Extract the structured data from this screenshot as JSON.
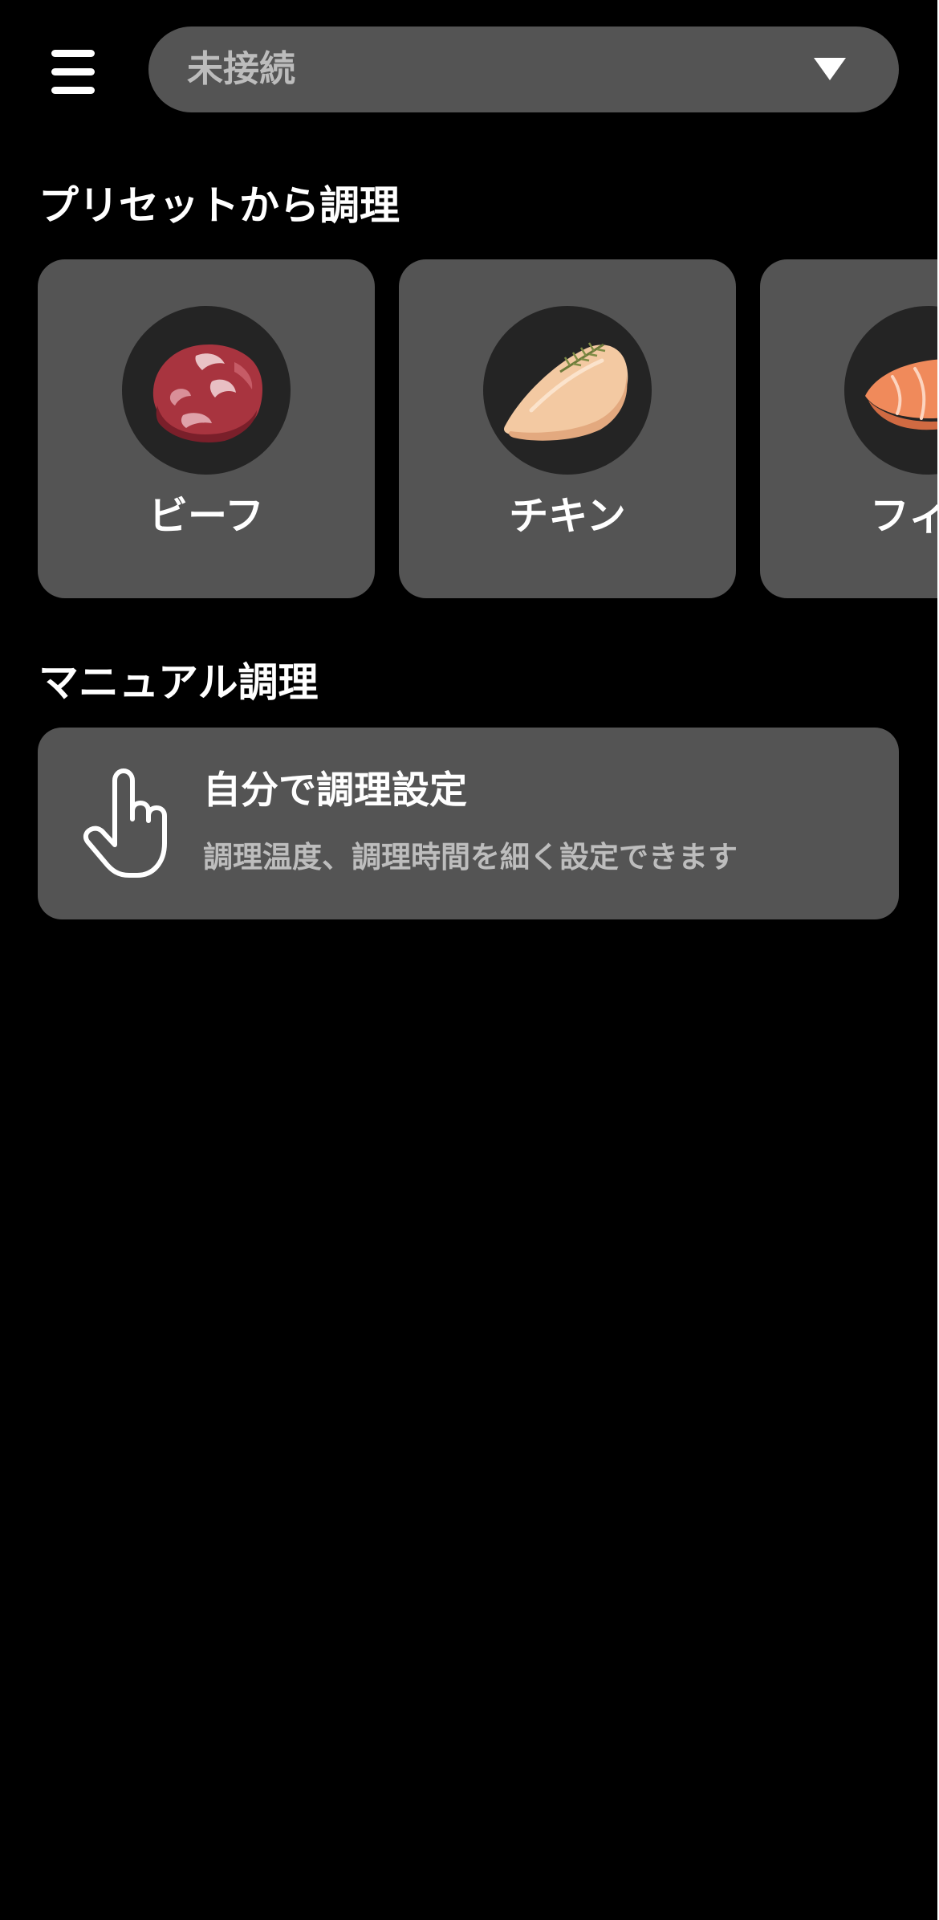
{
  "header": {
    "menu_icon": "hamburger-menu-icon",
    "device_select": {
      "value": "未接続",
      "caret_icon": "triangle-down-icon"
    }
  },
  "presets": {
    "title": "プリセットから調理",
    "items": [
      {
        "label": "ビーフ",
        "image": "beef-steak"
      },
      {
        "label": "チキン",
        "image": "chicken-breast"
      },
      {
        "label": "フィッ",
        "image": "salmon-fillet"
      }
    ]
  },
  "manual": {
    "title": "マニュアル調理",
    "card_title": "自分で調理設定",
    "card_description": "調理温度、調理時間を細く設定できます",
    "icon": "hand-pointer-icon"
  },
  "colors": {
    "background": "#000000",
    "card": "#545454",
    "image_circle": "#242424",
    "muted_text": "#bcbcbc"
  }
}
